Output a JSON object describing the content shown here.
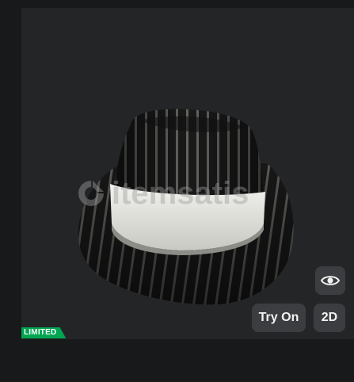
{
  "viewer": {
    "watermark_text": "itemsatis",
    "item_name": "pinstripe-fedora-hat"
  },
  "controls": {
    "view_icon": "eye-icon",
    "try_on_label": "Try On",
    "two_d_label": "2D"
  },
  "badge": {
    "label": "LIMITED",
    "color": "#00a551"
  },
  "colors": {
    "page_background": "#18191b",
    "viewer_background": "#232527",
    "button_background": "#3b3d40",
    "button_text": "#f2f2f2"
  }
}
